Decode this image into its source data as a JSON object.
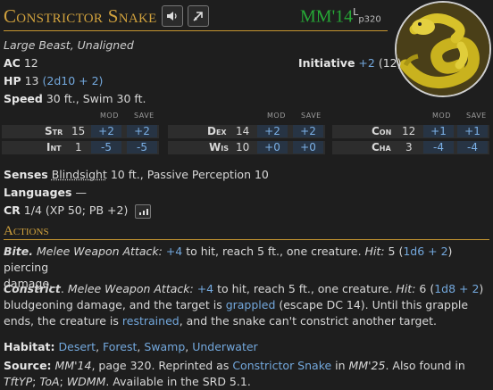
{
  "header": {
    "title": "Constrictor Snake",
    "source_code": "MM'14",
    "source_sup": "L",
    "source_page": "p320"
  },
  "creature": {
    "type_line": "Large Beast, Unaligned",
    "ac_label": "AC",
    "ac": "12",
    "init_label": "Initiative",
    "init_mod": "+2",
    "init_score": "(12)",
    "hp_label": "HP",
    "hp": "13",
    "hp_formula": "(2d10 + 2)",
    "speed_label": "Speed",
    "speed": "30 ft., Swim 30 ft."
  },
  "stats_header": {
    "mod": "MOD",
    "save": "SAVE"
  },
  "stats": [
    {
      "name": "Str",
      "score": "15",
      "mod": "+2",
      "save": "+2"
    },
    {
      "name": "Dex",
      "score": "14",
      "mod": "+2",
      "save": "+2"
    },
    {
      "name": "Con",
      "score": "12",
      "mod": "+1",
      "save": "+1"
    },
    {
      "name": "Int",
      "score": "1",
      "mod": "-5",
      "save": "-5"
    },
    {
      "name": "Wis",
      "score": "10",
      "mod": "+0",
      "save": "+0"
    },
    {
      "name": "Cha",
      "score": "3",
      "mod": "-4",
      "save": "-4"
    }
  ],
  "senses": {
    "label": "Senses",
    "blindsight": "Blindsight",
    "rest": " 10 ft., Passive Perception 10"
  },
  "languages": {
    "label": "Languages",
    "value": "—"
  },
  "cr": {
    "label": "CR",
    "value": "1/4 (XP 50; PB +2)"
  },
  "actions_heading": "Actions",
  "bite": {
    "name": "Bite.",
    "type": "Melee Weapon Attack:",
    "bonus": "+4",
    "text1": " to hit, reach 5 ft., one creature. ",
    "hit": "Hit:",
    "dmg1": " 5 (",
    "dice": "1d6 + 2",
    "text2": ") piercing",
    "line2": "damage."
  },
  "constrict": {
    "name": "Constrict",
    "type": "Melee Weapon Attack:",
    "bonus": "+4",
    "text1": " to hit, reach 5 ft., one creature. ",
    "hit": "Hit:",
    "dmg1": " 6 (",
    "dice": "1d8 + 2",
    "text2": ")",
    "l2a": "bludgeoning damage, and the target is ",
    "grappled": "grappled",
    "l2b": " (escape DC 14). Until this grapple",
    "l3a": "ends, the creature is ",
    "restrained": "restrained",
    "l3b": ", and the snake can't constrict another target."
  },
  "habitat": {
    "label": "Habitat:",
    "items": [
      "Desert",
      "Forest",
      "Swamp",
      "Underwater"
    ]
  },
  "source": {
    "label": "Source:",
    "book": "MM'14",
    "t1": ", page 320. Reprinted as ",
    "link": "Constrictor Snake",
    "t2": " in ",
    "book2": "MM'25",
    "t3": ". Also found in",
    "b3": "TftYP",
    "t4": "; ",
    "b4": "ToA",
    "t5": "; ",
    "b5": "WDMM",
    "t6": ". Available in the SRD 5.1."
  },
  "colors": {
    "title_gold": "#d0a13d",
    "source_green": "#26a836",
    "link_blue": "#73a8dd",
    "background": "#1e1e1e"
  },
  "icons": [
    "speaker-icon",
    "pin-icon",
    "bar-chart-icon"
  ]
}
